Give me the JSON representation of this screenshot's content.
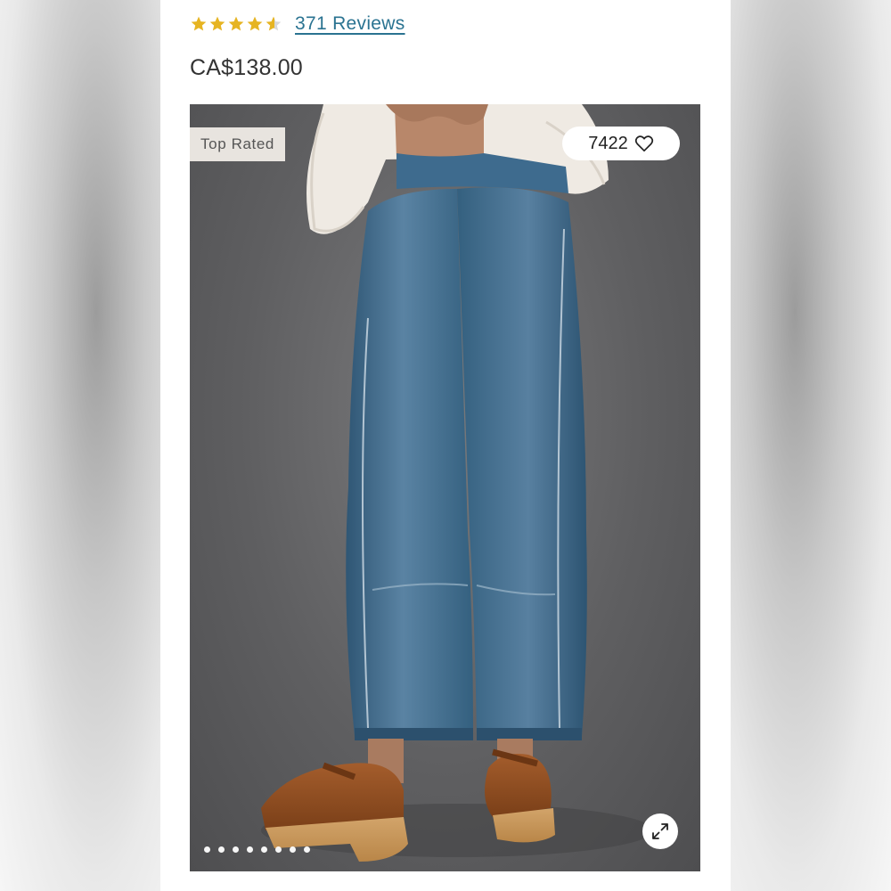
{
  "rating": {
    "value": 4.5,
    "max": 5,
    "star_color": "#e6b422",
    "empty_color": "#d8d8d8",
    "reviews_label": "371 Reviews"
  },
  "product": {
    "price": "CA$138.00"
  },
  "image": {
    "badge": "Top Rated",
    "favorites_count": "7422",
    "heart_icon": "heart-outline-icon",
    "expand_icon": "expand-arrows-icon",
    "carousel": {
      "total": 8,
      "active_index": 0
    }
  },
  "colors": {
    "link": "#2a7391",
    "price_text": "#333333",
    "image_background": "#5f5f61",
    "denim": "#3f6a8c"
  }
}
